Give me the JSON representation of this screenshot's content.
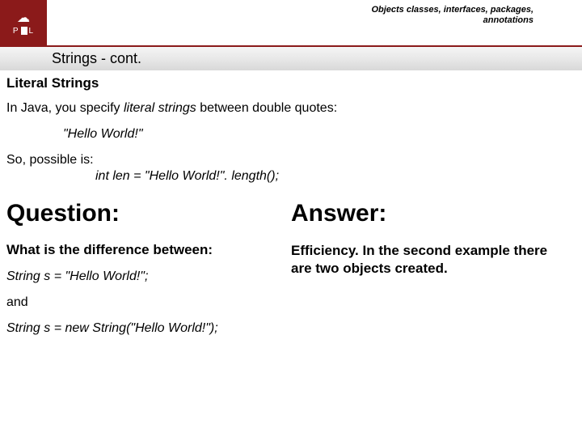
{
  "header": {
    "breadcrumb_line1": "Objects classes, interfaces, packages,",
    "breadcrumb_line2": "annotations",
    "logo_top": "☁",
    "logo_p": "P",
    "logo_l": "L"
  },
  "title": "Strings - cont.",
  "section": {
    "subtitle": "Literal Strings",
    "intro_prefix": "In Java, you specify ",
    "intro_em": "literal strings",
    "intro_suffix": " between double quotes:",
    "example": "\"Hello World!\"",
    "possible_label": "So, possible is:",
    "possible_code": "int len = \"Hello World!\". length();"
  },
  "qa": {
    "question_heading": "Question:",
    "question_sub": "What is the difference between:",
    "code1": "String s = \"Hello World!\";",
    "and": "and",
    "code2": "String s = new String(\"Hello World!\");",
    "answer_heading": "Answer:",
    "answer_text": "Efficiency. In the second example there are two objects created."
  }
}
